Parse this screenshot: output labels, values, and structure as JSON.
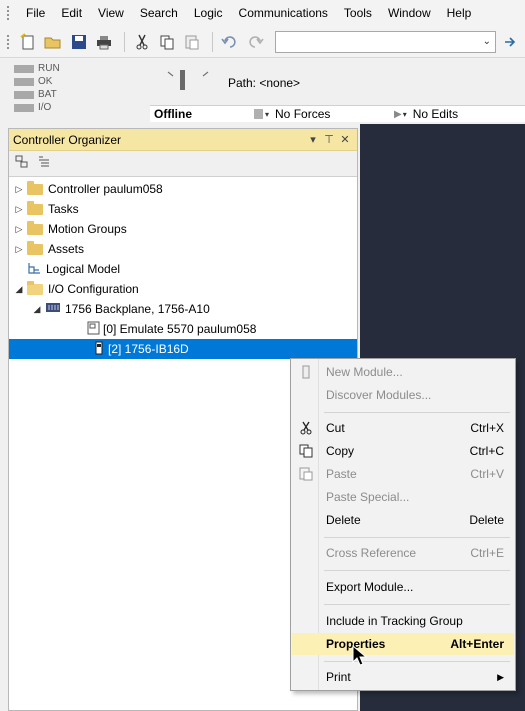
{
  "menubar": {
    "items": [
      "File",
      "Edit",
      "View",
      "Search",
      "Logic",
      "Communications",
      "Tools",
      "Window",
      "Help"
    ]
  },
  "toolbar": {
    "icons": [
      "new-icon",
      "open-icon",
      "save-icon",
      "print-icon",
      "cut-icon",
      "copy-icon",
      "paste-icon",
      "undo-icon",
      "redo-icon"
    ],
    "search_value": ""
  },
  "status": {
    "modes": [
      "RUN",
      "OK",
      "BAT",
      "I/O"
    ],
    "path_label": "Path: <none>",
    "offline": "Offline",
    "forces": "No Forces",
    "edits": "No Edits"
  },
  "organizer": {
    "title": "Controller Organizer",
    "tree": [
      {
        "label": "Controller paulum058",
        "icon": "folder-icon"
      },
      {
        "label": "Tasks",
        "icon": "folder-icon"
      },
      {
        "label": "Motion Groups",
        "icon": "folder-icon"
      },
      {
        "label": "Assets",
        "icon": "folder-icon"
      },
      {
        "label": "Logical Model",
        "icon": "logical-model-icon"
      },
      {
        "label": "I/O Configuration",
        "icon": "folder-open-icon"
      },
      {
        "label": "1756 Backplane, 1756-A10",
        "icon": "backplane-icon"
      },
      {
        "label": "[0] Emulate 5570 paulum058",
        "icon": "controller-module-icon"
      },
      {
        "label": "[2] 1756-IB16D",
        "icon": "io-module-icon"
      }
    ]
  },
  "context_menu": {
    "items": [
      {
        "label": "New Module...",
        "shortcut": "",
        "enabled": false
      },
      {
        "label": "Discover Modules...",
        "shortcut": "",
        "enabled": false
      },
      {
        "label": "Cut",
        "shortcut": "Ctrl+X",
        "enabled": true
      },
      {
        "label": "Copy",
        "shortcut": "Ctrl+C",
        "enabled": true
      },
      {
        "label": "Paste",
        "shortcut": "Ctrl+V",
        "enabled": false
      },
      {
        "label": "Paste Special...",
        "shortcut": "",
        "enabled": false
      },
      {
        "label": "Delete",
        "shortcut": "Delete",
        "enabled": true
      },
      {
        "label": "Cross Reference",
        "shortcut": "Ctrl+E",
        "enabled": false
      },
      {
        "label": "Export Module...",
        "shortcut": "",
        "enabled": true
      },
      {
        "label": "Include in Tracking Group",
        "shortcut": "",
        "enabled": true
      },
      {
        "label": "Properties",
        "shortcut": "Alt+Enter",
        "enabled": true
      },
      {
        "label": "Print",
        "shortcut": "",
        "enabled": true
      }
    ]
  },
  "colors": {
    "selection": "#0078d7",
    "organizer_header": "#f5e6a3",
    "menu_hover": "#fcf0b4",
    "workarea": "#262c3b"
  }
}
